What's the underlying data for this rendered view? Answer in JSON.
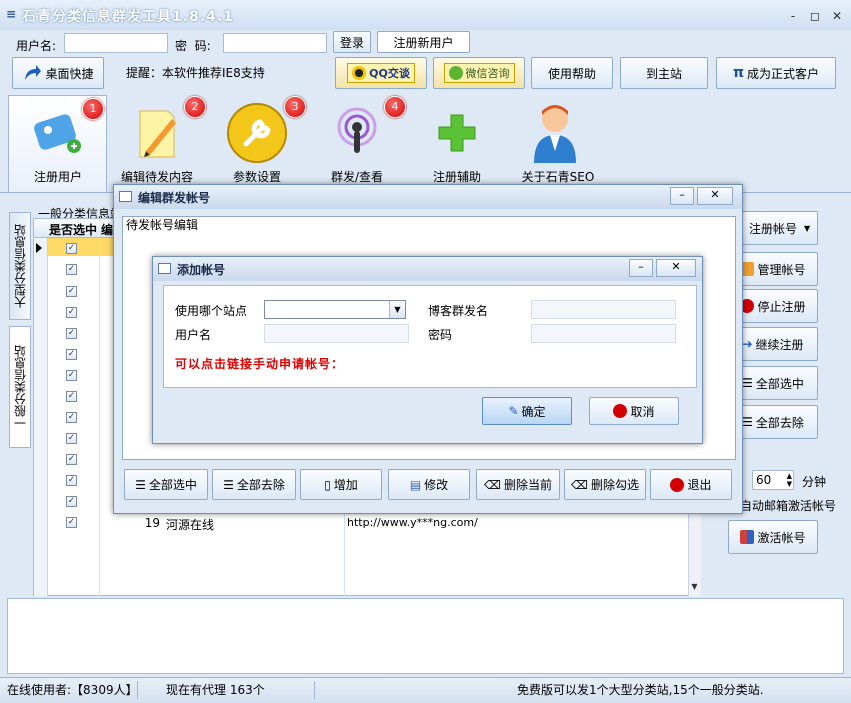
{
  "app": {
    "title": "石青分类信息群发工具1.8.4.1",
    "minimize": "-",
    "restore": "◻",
    "close": "✕"
  },
  "login": {
    "username_label": "用户名:",
    "password_label": "密  码:",
    "login_button": "登录",
    "register_button": "注册新用户",
    "username_value": "",
    "password_value": ""
  },
  "toolbar": {
    "desktop_shortcut": "桌面快捷",
    "tip": "提醒：本软件推荐IE8支持",
    "qq": "QQ交谈",
    "wechat": "微信咨询",
    "help": "使用帮助",
    "home": "到主站",
    "become_customer": "成为正式客户"
  },
  "tools": [
    {
      "label": "注册用户",
      "badge": "1",
      "icon": "register-user-icon"
    },
    {
      "label": "编辑待发内容",
      "badge": "2",
      "icon": "edit-content-icon"
    },
    {
      "label": "参数设置",
      "badge": "3",
      "icon": "settings-wrench-icon"
    },
    {
      "label": "群发/查看",
      "badge": "4",
      "icon": "broadcast-icon"
    },
    {
      "label": "注册辅助",
      "badge": "",
      "icon": "plus-icon"
    },
    {
      "label": "关于石青SEO",
      "badge": "",
      "icon": "about-person-icon"
    }
  ],
  "side_tabs": [
    "大型分类信息站",
    "一般分类信息站"
  ],
  "grid": {
    "group_label": "一般分类信息站",
    "columns": [
      "是否选中",
      "编"
    ],
    "visible_row": {
      "num": "19",
      "name": "河源在线",
      "url": "http://www.y***ng.com/"
    }
  },
  "right_panel": {
    "register_account": "注册帐号",
    "manage_account": "管理帐号",
    "stop_register": "停止注册",
    "continue_register": "继续注册",
    "select_all": "全部选中",
    "deselect_all": "全部去除",
    "interval_value": "60",
    "minutes": "分钟",
    "auto_activate": "自动邮箱激活帐号",
    "activate_account": "激活帐号"
  },
  "edit_dialog": {
    "title": "编辑群发帐号",
    "group": "待发帐号编辑",
    "buttons": [
      "全部选中",
      "全部去除",
      "增加",
      "修改",
      "删除当前",
      "删除勾选",
      "退出"
    ]
  },
  "add_dialog": {
    "title": "添加帐号",
    "site_label": "使用哪个站点",
    "blog_label": "博客群发名",
    "user_label": "用户名",
    "password_label": "密码",
    "site_value": "",
    "blog_value": "",
    "user_value": "",
    "password_value": "",
    "link_text": "可以点击链接手动申请帐号：",
    "confirm": "确定",
    "cancel": "取消"
  },
  "status": {
    "online_users": "在线使用者:【8309人】",
    "proxies": "现在有代理 163个",
    "free_note": "免费版可以发1个大型分类站,15个一般分类站."
  },
  "colors": {
    "accent": "#1f4f8f",
    "link_red": "#e00000",
    "badge_red": "#d20000"
  }
}
